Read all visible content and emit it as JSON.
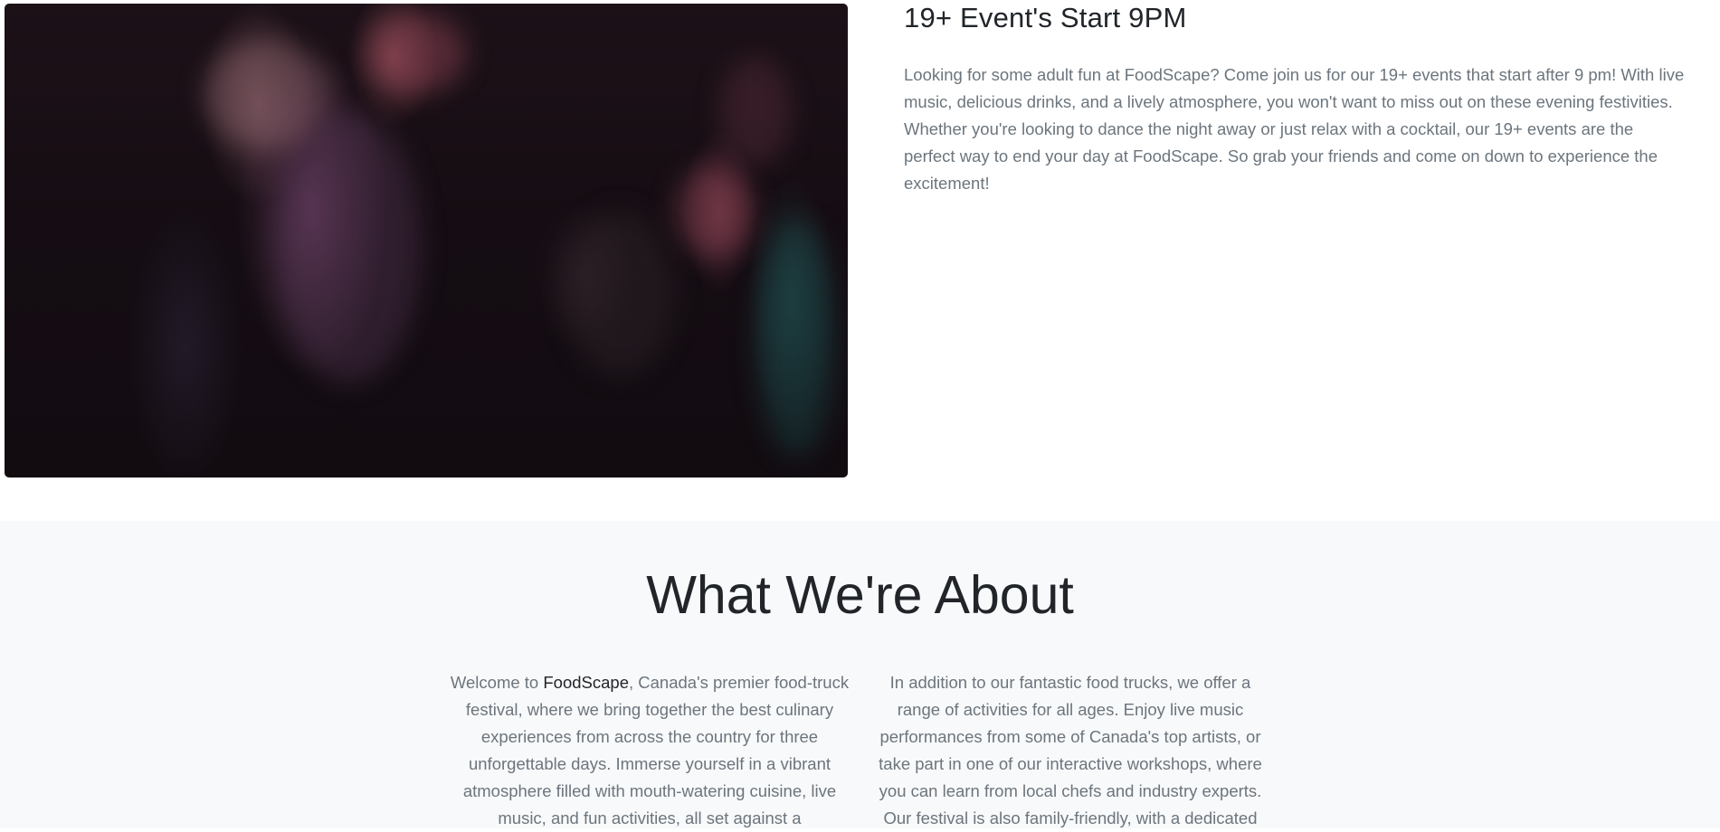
{
  "event": {
    "title": "19+ Event's Start 9PM",
    "description": "Looking for some adult fun at FoodScape? Come join us for our 19+ events that start after 9 pm! With live music, delicious drinks, and a lively atmosphere, you won't want to miss out on these evening festivities. Whether you're looking to dance the night away or just relax with a cocktail, our 19+ events are the perfect way to end your day at FoodScape. So grab your friends and come on down to experience the excitement!"
  },
  "about": {
    "title": "What We're About",
    "left_intro": "Welcome to ",
    "brand": "FoodScape",
    "left_rest": ", Canada's premier food-truck festival, where we bring together the best culinary experiences from across the country for three unforgettable days. Immerse yourself in a vibrant atmosphere filled with mouth-watering cuisine, live music, and fun activities, all set against a",
    "right": "In addition to our fantastic food trucks, we offer a range of activities for all ages. Enjoy live music performances from some of Canada's top artists, or take part in one of our interactive workshops, where you can learn from local chefs and industry experts. Our festival is also family-friendly, with a dedicated"
  }
}
